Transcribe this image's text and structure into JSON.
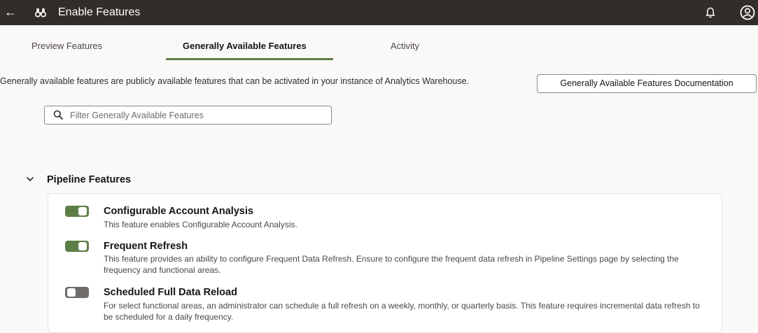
{
  "header": {
    "title": "Enable Features",
    "back_icon": "arrow-left-icon",
    "app_icon": "binoculars-icon",
    "notification_icon": "bell-icon",
    "user_icon": "user-avatar-icon"
  },
  "tabs": [
    {
      "label": "Preview Features",
      "active": false
    },
    {
      "label": "Generally Available Features",
      "active": true
    },
    {
      "label": "Activity",
      "active": false
    }
  ],
  "main": {
    "description": "Generally available features are publicly available features that can be activated in your instance of Analytics Warehouse.",
    "doc_button_label": "Generally Available Features Documentation",
    "filter_placeholder": "Filter Generally Available Features",
    "filter_value": ""
  },
  "section": {
    "title": "Pipeline Features",
    "expanded": true,
    "features": [
      {
        "name": "Configurable Account Analysis",
        "enabled": true,
        "description": "This feature enables Configurable Account Analysis."
      },
      {
        "name": "Frequent Refresh",
        "enabled": true,
        "description": "This feature provides an ability to configure Frequent Data Refresh. Ensure to configure the frequent data refresh in Pipeline Settings page by selecting the frequency and functional areas."
      },
      {
        "name": "Scheduled Full Data Reload",
        "enabled": false,
        "description": "For select functional areas, an administrator can schedule a full refresh on a weekly, monthly, or quarterly basis. This feature requires incremental data refresh to be scheduled for a daily frequency."
      }
    ]
  },
  "colors": {
    "header_bg": "#312d2a",
    "accent_green": "#5e7e47",
    "toggle_off": "#6f6c69",
    "page_bg": "#fbf9f8"
  }
}
